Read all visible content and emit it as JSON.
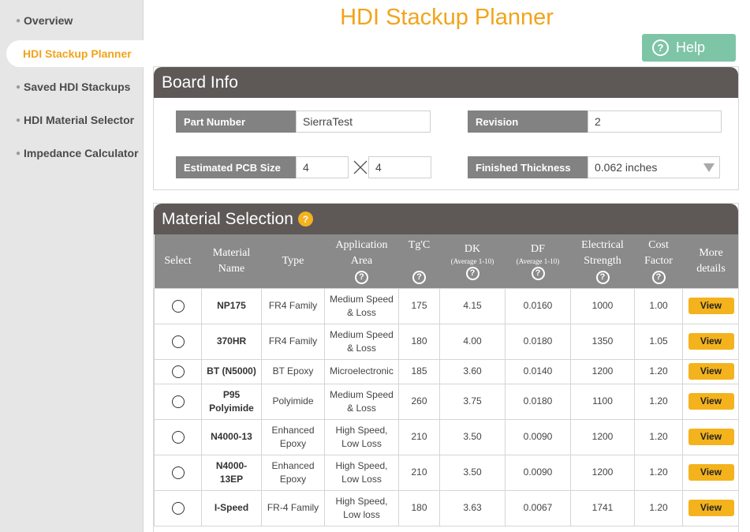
{
  "sidebar": {
    "items": [
      {
        "label": "Overview",
        "active": false
      },
      {
        "label": "HDI Stackup Planner",
        "active": true
      },
      {
        "label": "Saved HDI Stackups",
        "active": false
      },
      {
        "label": "HDI Material Selector",
        "active": false
      },
      {
        "label": "Impedance Calculator",
        "active": false
      }
    ]
  },
  "header": {
    "title": "HDI Stackup Planner",
    "help_label": "Help",
    "help_icon": "question-circle-icon"
  },
  "board_info": {
    "title": "Board Info",
    "part_number_label": "Part Number",
    "part_number_value": "SierraTest",
    "revision_label": "Revision",
    "revision_value": "2",
    "pcb_size_label": "Estimated PCB Size",
    "pcb_size_x": "4",
    "pcb_size_y": "4",
    "thickness_label": "Finished Thickness",
    "thickness_value": "0.062 inches"
  },
  "material_selection": {
    "title": "Material Selection",
    "headers": {
      "select": "Select",
      "material_name": [
        "Material",
        "Name"
      ],
      "type": "Type",
      "application_area": [
        "Application",
        "Area"
      ],
      "tg": "Tg'C",
      "dk": "DK",
      "dk_sub": "(Average 1-10)",
      "df": "DF",
      "df_sub": "(Average 1-10)",
      "electrical_strength": [
        "Electrical",
        "Strength"
      ],
      "cost_factor": [
        "Cost",
        "Factor"
      ],
      "more_details": [
        "More",
        "details"
      ]
    },
    "view_label": "View",
    "rows": [
      {
        "name": [
          "NP175"
        ],
        "type": [
          "FR4 Family"
        ],
        "app": [
          "Medium Speed",
          "& Loss"
        ],
        "tg": "175",
        "dk": "4.15",
        "df": "0.0160",
        "es": "1000",
        "cost": "1.00"
      },
      {
        "name": [
          "370HR"
        ],
        "type": [
          "FR4 Family"
        ],
        "app": [
          "Medium Speed",
          "& Loss"
        ],
        "tg": "180",
        "dk": "4.00",
        "df": "0.0180",
        "es": "1350",
        "cost": "1.05"
      },
      {
        "name": [
          "BT (N5000)"
        ],
        "type": [
          "BT Epoxy"
        ],
        "app": [
          "Microelectronic"
        ],
        "tg": "185",
        "dk": "3.60",
        "df": "0.0140",
        "es": "1200",
        "cost": "1.20"
      },
      {
        "name": [
          "P95",
          "Polyimide"
        ],
        "type": [
          "Polyimide"
        ],
        "app": [
          "Medium Speed",
          "& Loss"
        ],
        "tg": "260",
        "dk": "3.75",
        "df": "0.0180",
        "es": "1100",
        "cost": "1.20"
      },
      {
        "name": [
          "N4000-13"
        ],
        "type": [
          "Enhanced",
          "Epoxy"
        ],
        "app": [
          "High Speed,",
          "Low Loss"
        ],
        "tg": "210",
        "dk": "3.50",
        "df": "0.0090",
        "es": "1200",
        "cost": "1.20"
      },
      {
        "name": [
          "N4000-",
          "13EP"
        ],
        "type": [
          "Enhanced",
          "Epoxy"
        ],
        "app": [
          "High Speed,",
          "Low Loss"
        ],
        "tg": "210",
        "dk": "3.50",
        "df": "0.0090",
        "es": "1200",
        "cost": "1.20"
      },
      {
        "name": [
          "I-Speed"
        ],
        "type": [
          "FR-4 Family"
        ],
        "app": [
          "High Speed,",
          "Low loss"
        ],
        "tg": "180",
        "dk": "3.63",
        "df": "0.0067",
        "es": "1741",
        "cost": "1.20"
      }
    ]
  }
}
